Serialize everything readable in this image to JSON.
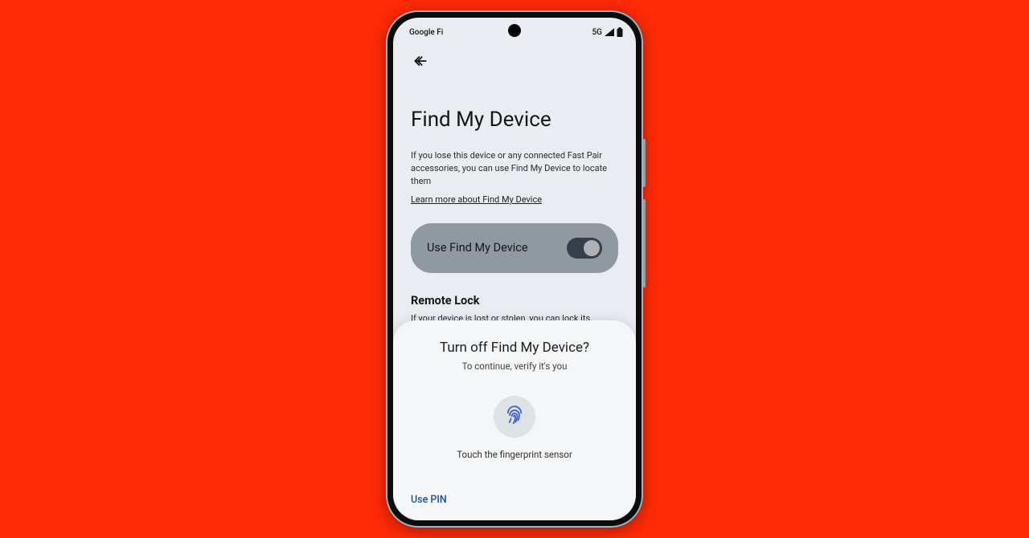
{
  "status": {
    "carrier": "Google Fi",
    "network": "5G"
  },
  "settings": {
    "title": "Find My Device",
    "description": "If you lose this device or any connected Fast Pair accessories, you can use Find My Device to locate them",
    "learn_more": "Learn more about Find My Device",
    "toggle_label": "Use Find My Device",
    "remote_lock_heading": "Remote Lock",
    "remote_lock_desc": "If your device is lost or stolen, you can lock its screen with just a phone number"
  },
  "sheet": {
    "title": "Turn off Find My Device?",
    "subtitle": "To continue, verify it's you",
    "sensor_hint": "Touch the fingerprint sensor",
    "use_pin": "Use PIN"
  }
}
